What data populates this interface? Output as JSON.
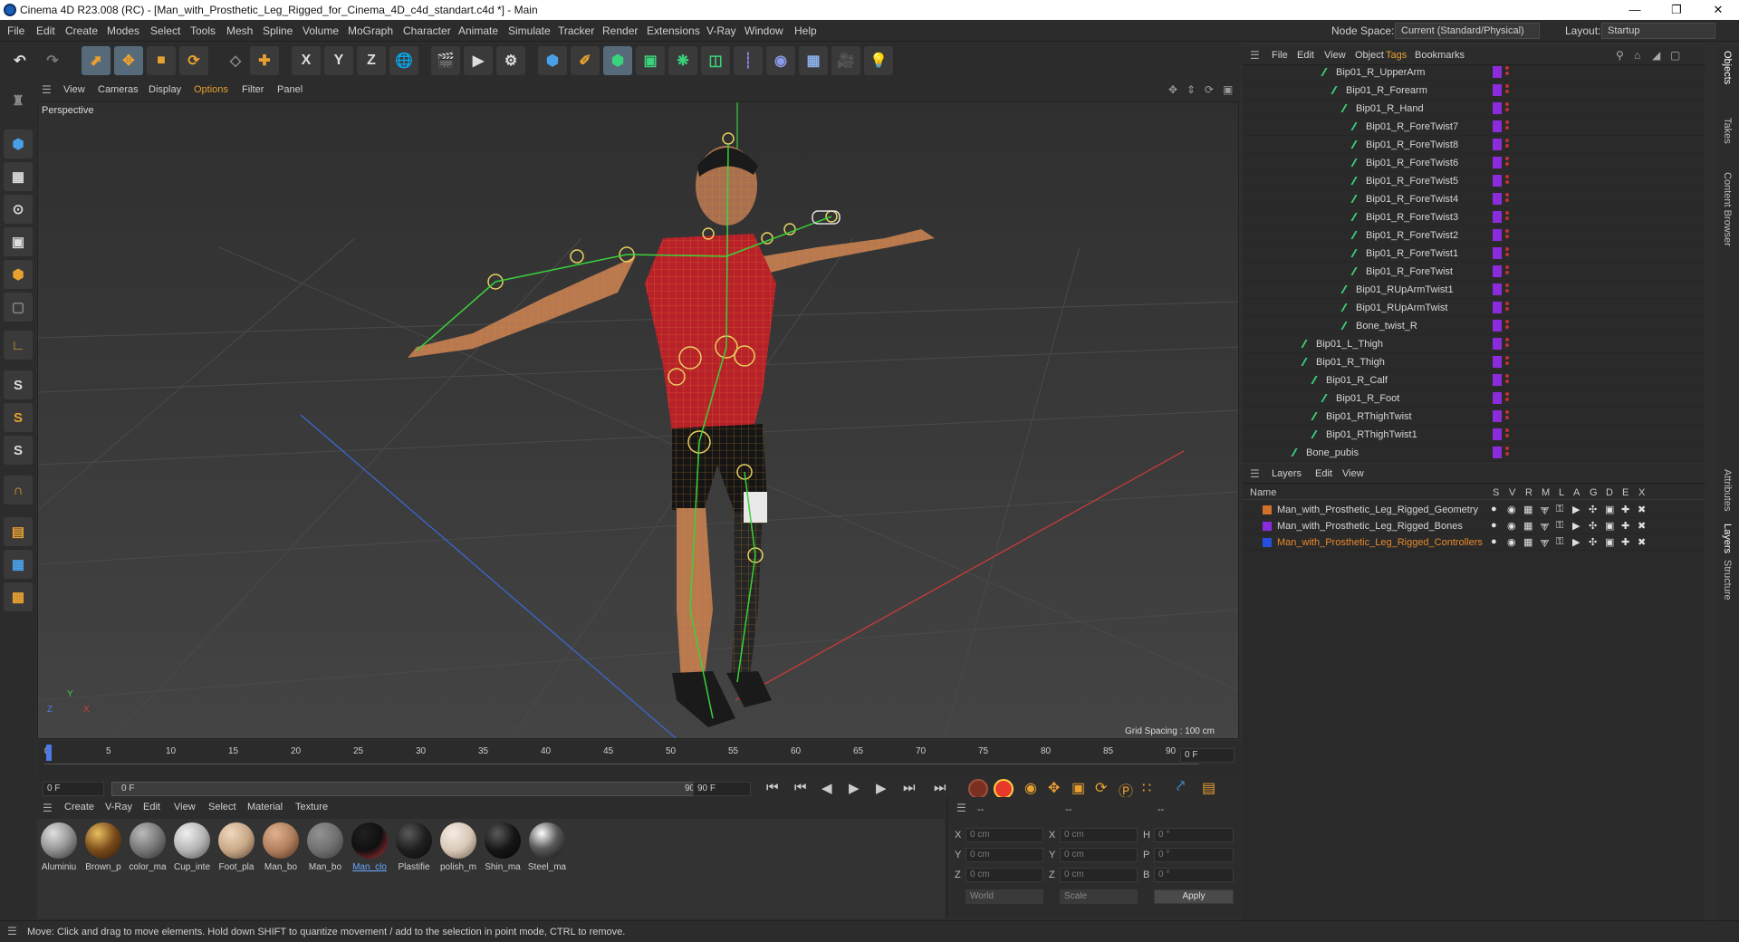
{
  "title": "Cinema 4D R23.008 (RC) - [Man_with_Prosthetic_Leg_Rigged_for_Cinema_4D_c4d_standart.c4d *] - Main",
  "window_controls": [
    "—",
    "❐",
    "✕"
  ],
  "menu": [
    "File",
    "Edit",
    "Create",
    "Modes",
    "Select",
    "Tools",
    "Mesh",
    "Spline",
    "Volume",
    "MoGraph",
    "Character",
    "Animate",
    "Simulate",
    "Tracker",
    "Render",
    "Extensions",
    "V-Ray",
    "Window",
    "Help"
  ],
  "nodespace": {
    "label": "Node Space:",
    "value": "Current (Standard/Physical)"
  },
  "layout": {
    "label": "Layout:",
    "value": "Startup"
  },
  "toolbar_letters": {
    "x": "X",
    "y": "Y",
    "z": "Z"
  },
  "left_letters": [
    "S",
    "S",
    "S"
  ],
  "viewport": {
    "menu": [
      "View",
      "Cameras",
      "Display",
      "Options",
      "Filter",
      "Panel"
    ],
    "label": "Perspective",
    "grid_spacing": "Grid Spacing : 100 cm",
    "axis": {
      "x": "X",
      "y": "Y",
      "z": "Z"
    }
  },
  "timeline": {
    "ticks": [
      "0",
      "5",
      "10",
      "15",
      "20",
      "25",
      "30",
      "35",
      "40",
      "45",
      "50",
      "55",
      "60",
      "65",
      "70",
      "75",
      "80",
      "85",
      "90"
    ],
    "current": "0 F",
    "start": "0 F",
    "range_start": "0 F",
    "range_end": "90 F",
    "end": "90 F"
  },
  "materials": {
    "menu": [
      "Create",
      "V-Ray",
      "Edit",
      "View",
      "Select",
      "Material",
      "Texture"
    ],
    "items": [
      {
        "name": "Aluminiu",
        "color": "#9a9a9a"
      },
      {
        "name": "Brown_p",
        "color": "#7a4a1a"
      },
      {
        "name": "color_ma",
        "color": "#777777"
      },
      {
        "name": "Cup_inte",
        "color": "#b5b5b5"
      },
      {
        "name": "Foot_pla",
        "color": "#c9a988"
      },
      {
        "name": "Man_bo",
        "color": "#b0805e"
      },
      {
        "name": "Man_bo",
        "color": "#8a8a8a"
      },
      {
        "name": "Man_clo",
        "color": "#c0303a"
      },
      {
        "name": "Plastifie",
        "color": "#1e1e1e"
      },
      {
        "name": "polish_m",
        "color": "#d8c8b8"
      },
      {
        "name": "Shin_ma",
        "color": "#151515"
      },
      {
        "name": "Steel_ma",
        "color": "#5a5a5a"
      }
    ]
  },
  "coords": {
    "header": [
      "--",
      "--",
      "--"
    ],
    "rows": [
      {
        "a": "X",
        "av": "0 cm",
        "b": "X",
        "bv": "0 cm",
        "c": "H",
        "cv": "0 °"
      },
      {
        "a": "Y",
        "av": "0 cm",
        "b": "Y",
        "bv": "0 cm",
        "c": "P",
        "cv": "0 °"
      },
      {
        "a": "Z",
        "av": "0 cm",
        "b": "Z",
        "bv": "0 cm",
        "c": "B",
        "cv": "0 °"
      }
    ],
    "world": "World",
    "scale": "Scale",
    "apply": "Apply"
  },
  "object_manager": {
    "menu": [
      "File",
      "Edit",
      "View",
      "Object",
      "Tags",
      "Bookmarks"
    ],
    "rows": [
      {
        "name": "Bip01_R_UpperArm",
        "indent": 2
      },
      {
        "name": "Bip01_R_Forearm",
        "indent": 3
      },
      {
        "name": "Bip01_R_Hand",
        "indent": 4
      },
      {
        "name": "Bip01_R_ForeTwist7",
        "indent": 5
      },
      {
        "name": "Bip01_R_ForeTwist8",
        "indent": 5
      },
      {
        "name": "Bip01_R_ForeTwist6",
        "indent": 5
      },
      {
        "name": "Bip01_R_ForeTwist5",
        "indent": 5
      },
      {
        "name": "Bip01_R_ForeTwist4",
        "indent": 5
      },
      {
        "name": "Bip01_R_ForeTwist3",
        "indent": 5
      },
      {
        "name": "Bip01_R_ForeTwist2",
        "indent": 5
      },
      {
        "name": "Bip01_R_ForeTwist1",
        "indent": 5
      },
      {
        "name": "Bip01_R_ForeTwist",
        "indent": 5
      },
      {
        "name": "Bip01_RUpArmTwist1",
        "indent": 4
      },
      {
        "name": "Bip01_RUpArmTwist",
        "indent": 4
      },
      {
        "name": "Bone_twist_R",
        "indent": 4
      },
      {
        "name": "Bip01_L_Thigh",
        "indent": 0
      },
      {
        "name": "Bip01_R_Thigh",
        "indent": 0
      },
      {
        "name": "Bip01_R_Calf",
        "indent": 1
      },
      {
        "name": "Bip01_R_Foot",
        "indent": 2
      },
      {
        "name": "Bip01_RThighTwist",
        "indent": 1
      },
      {
        "name": "Bip01_RThighTwist1",
        "indent": 1
      },
      {
        "name": "Bone_pubis",
        "indent": -1
      }
    ]
  },
  "layers": {
    "menu": [
      "Layers",
      "Edit",
      "View"
    ],
    "columns": [
      "Name",
      "S",
      "V",
      "R",
      "M",
      "L",
      "A",
      "G",
      "D",
      "E",
      "X"
    ],
    "items": [
      {
        "name": "Man_with_Prosthetic_Leg_Rigged_Geometry",
        "color": "#d0702a",
        "text_color": "#d6d6d6"
      },
      {
        "name": "Man_with_Prosthetic_Leg_Rigged_Bones",
        "color": "#8a2cdc",
        "text_color": "#d6d6d6"
      },
      {
        "name": "Man_with_Prosthetic_Leg_Rigged_Controllers",
        "color": "#2850e0",
        "text_color": "#e8892a"
      }
    ]
  },
  "right_tabs": [
    "Objects",
    "Takes",
    "Content Browser",
    "Attributes",
    "Layers",
    "Structure"
  ],
  "status": "Move: Click and drag to move elements. Hold down SHIFT to quantize movement / add to the selection in point mode, CTRL to remove."
}
